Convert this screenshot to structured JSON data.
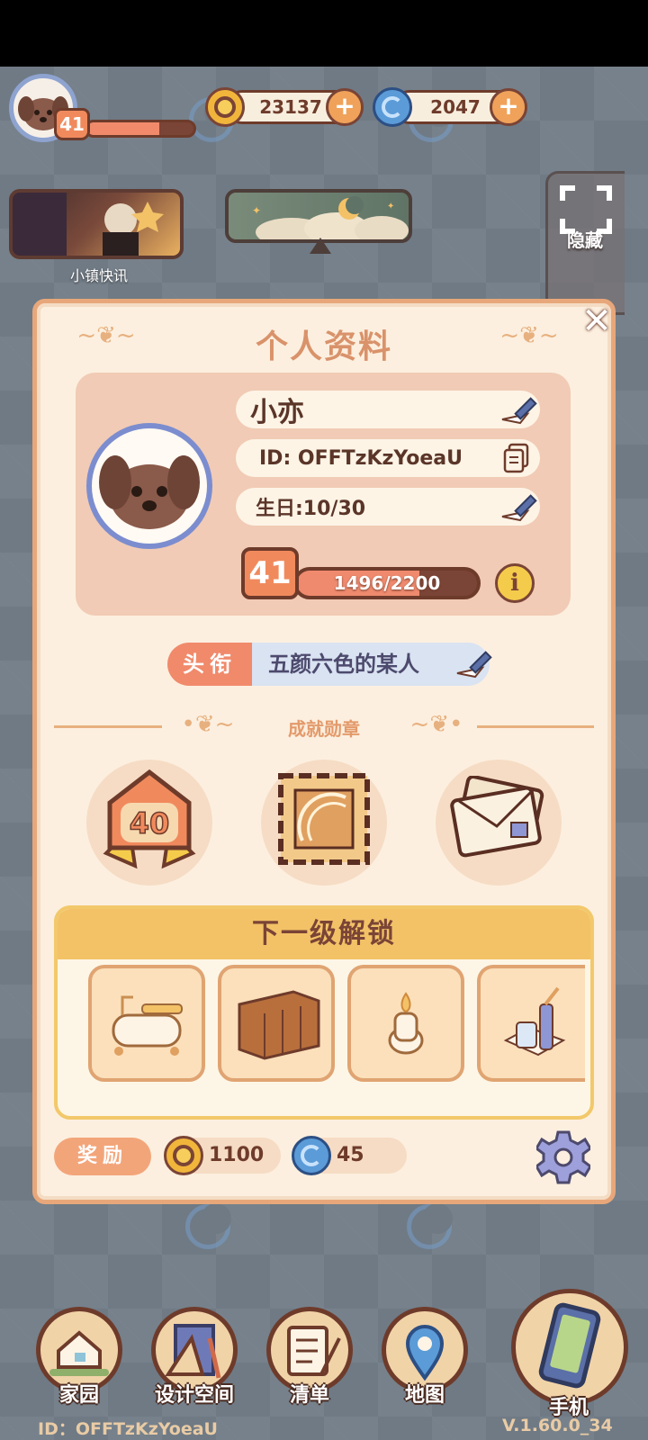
{
  "hud": {
    "level": "41",
    "xp_fraction": 0.68,
    "coins": "23137",
    "gems": "2047"
  },
  "left_panel": {
    "news_label": "小镇快讯"
  },
  "right_panel": {
    "hide_label": "隐藏"
  },
  "profile_modal": {
    "title": "个人资料",
    "name": "小亦",
    "id": "ID: OFFTzKzYoeaU",
    "birthday": "生日:10/30",
    "level": "41",
    "xp_text": "1496/2200",
    "xp_fraction": 0.68,
    "title_tag": "头衔",
    "title_value": "五颜六色的某人",
    "section_label": "成就勋章",
    "medals": [
      {
        "name": "level-40-medal",
        "text": "40"
      },
      {
        "name": "stamp-medal",
        "text": ""
      },
      {
        "name": "letter-medal",
        "text": ""
      }
    ],
    "unlock_title": "下一级解锁",
    "unlock_items": [
      "bathtub",
      "cabinet",
      "candle",
      "glass"
    ],
    "reward_label": "奖励",
    "reward_coins": "1100",
    "reward_gems": "45"
  },
  "bottom_nav": {
    "items": [
      {
        "label": "家园",
        "icon": "home-icon"
      },
      {
        "label": "设计空间",
        "icon": "design-icon"
      },
      {
        "label": "清单",
        "icon": "list-icon"
      },
      {
        "label": "地图",
        "icon": "map-pin-icon"
      }
    ],
    "phone_label": "手机"
  },
  "footer": {
    "player_id": "ID：OFFTzKzYoeaU",
    "version": "V.1.60.0_34"
  },
  "colors": {
    "accent_orange": "#f08a5d",
    "panel_cream": "#fcefdf",
    "outline_brown": "#6e3b2b",
    "title_blue": "#d9e3f2"
  }
}
